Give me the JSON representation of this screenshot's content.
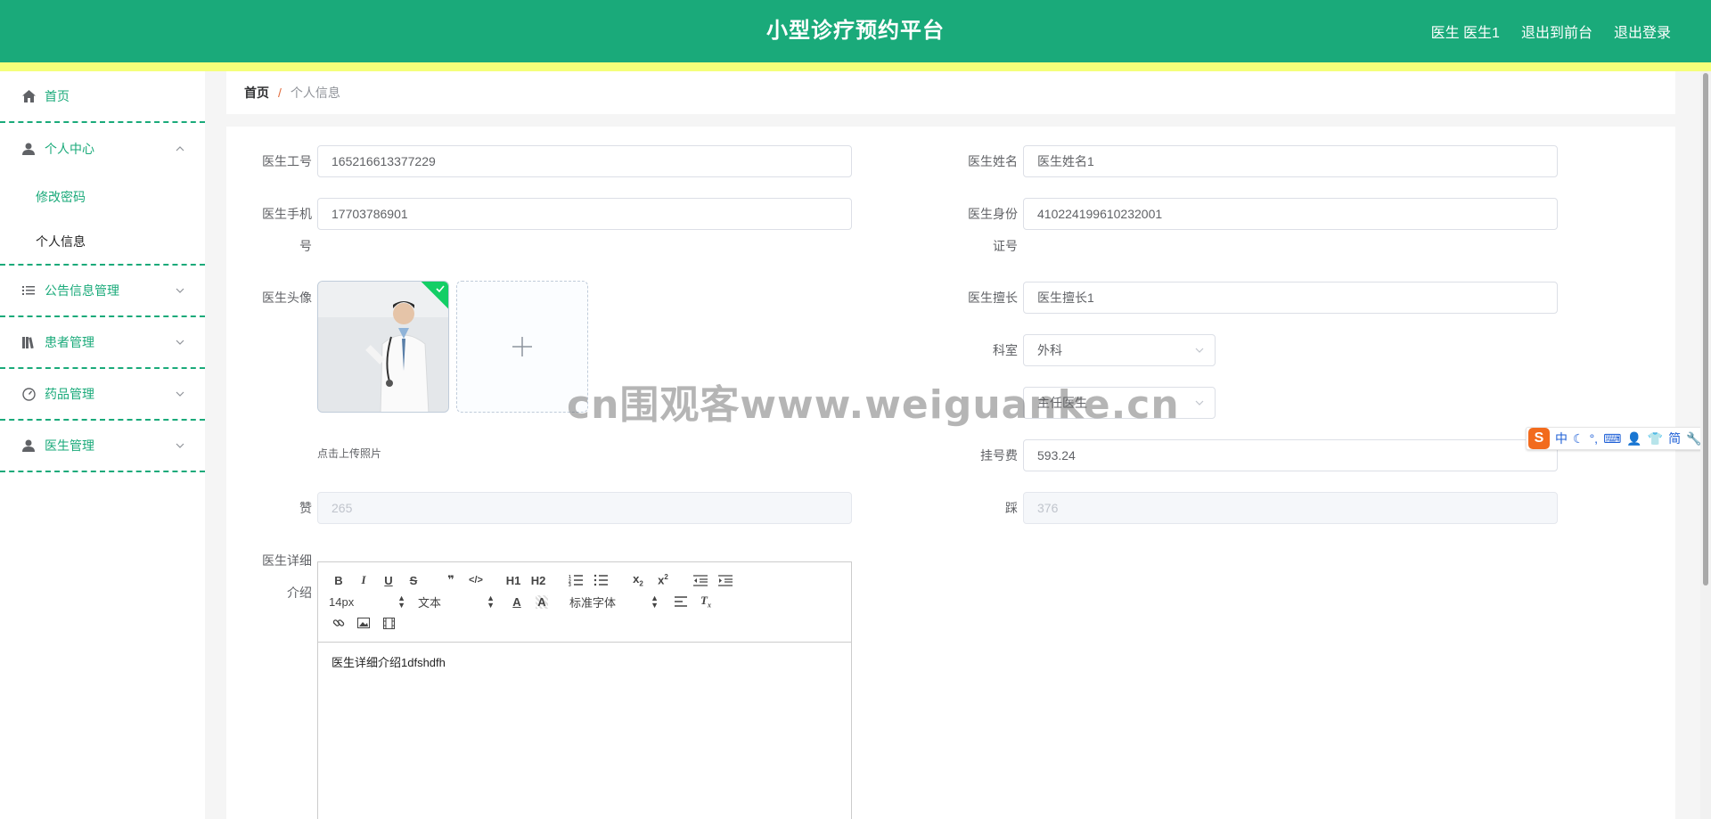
{
  "header": {
    "title": "小型诊疗预约平台",
    "user_label": "医生 医生1",
    "to_front": "退出到前台",
    "logout": "退出登录"
  },
  "sidebar": {
    "items": [
      {
        "label": "首页",
        "icon": "home-icon"
      },
      {
        "label": "个人中心",
        "icon": "user-icon",
        "expanded": true,
        "children": [
          {
            "label": "修改密码"
          },
          {
            "label": "个人信息",
            "active": true
          }
        ]
      },
      {
        "label": "公告信息管理",
        "icon": "list-icon"
      },
      {
        "label": "患者管理",
        "icon": "books-icon"
      },
      {
        "label": "药品管理",
        "icon": "gauge-icon"
      },
      {
        "label": "医生管理",
        "icon": "user-icon"
      }
    ]
  },
  "breadcrumb": {
    "home": "首页",
    "separator": "/",
    "current": "个人信息"
  },
  "form": {
    "doctor_id": {
      "label": "医生工号",
      "value": "165216613377229"
    },
    "doctor_name": {
      "label": "医生姓名",
      "value": "医生姓名1"
    },
    "doctor_phone": {
      "label_line1": "医生手机",
      "label_line2": "号",
      "value": "17703786901"
    },
    "doctor_idcard": {
      "label_line1": "医生身份",
      "label_line2": "证号",
      "value": "410224199610232001"
    },
    "avatar": {
      "label": "医生头像",
      "tip": "点击上传照片"
    },
    "specialty": {
      "label": "医生擅长",
      "value": "医生擅长1"
    },
    "department": {
      "label": "科室",
      "value": "外科"
    },
    "title_field": {
      "value": "主任医生"
    },
    "fee": {
      "label": "挂号费",
      "value": "593.24"
    },
    "likes": {
      "label": "赞",
      "value": "265"
    },
    "dislikes": {
      "label": "踩",
      "value": "376"
    },
    "intro": {
      "label_line1": "医生详细",
      "label_line2": "介绍",
      "value": "医生详细介绍1dfshdfh"
    }
  },
  "editor_toolbar": {
    "font_size": "14px",
    "block_type": "文本",
    "font_family": "标准字体",
    "h1": "H1",
    "h2": "H2"
  },
  "watermark": "cn围观客www.weiguanke.cn",
  "ime": {
    "lang": "中",
    "simplified": "简"
  },
  "colors": {
    "primary": "#1aaa7a",
    "stripe": "#f5ff7a",
    "success": "#13ce66"
  }
}
